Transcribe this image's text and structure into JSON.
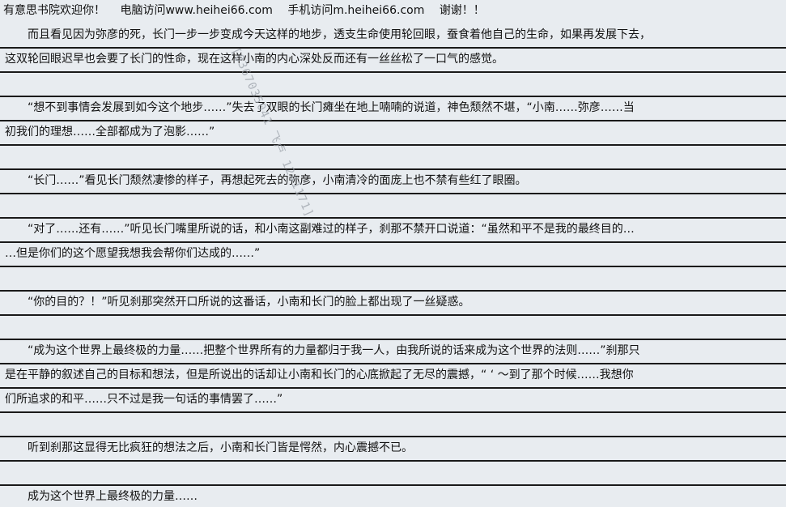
{
  "header": {
    "welcome": "有意思书院欢迎你！",
    "pc": "电脑访问www.heihei66.com",
    "mobile": "手机访问m.heihei66.com",
    "thanks": "谢谢！！"
  },
  "lines": [
    "　　而且看见因为弥彦的死，长门一步一步变成今天这样的地步，透支生命使用轮回眼，蚕食着他自己的生命，如果再发展下去，",
    "这双轮回眼迟早也会要了长门的性命，现在这样小南的内心深处反而还有一丝丝松了一口气的感觉。",
    "",
    "　　“想不到事情会发展到如今这个地步……”失去了双眼的长门瘫坐在地上喃喃的说道，神色颓然不堪，“小南……弥彦……当",
    "初我们的理想……全部都成为了泡影……”",
    "",
    "　　“长门……”看见长门颓然凄惨的样子，再想起死去的弥彦，小南清冷的面庞上也不禁有些红了眼圈。",
    "",
    "　　“对了……还有……”听见长门嘴里所说的话，和小南这副难过的样子，刹那不禁开口说道：“虽然和平不是我的最终目的…",
    "…但是你们的这个愿望我想我会帮你们达成的……”",
    "",
    "　　“你的目的？！”听见刹那突然开口所说的这番话，小南和长门的脸上都出现了一丝疑惑。",
    "",
    "　　“成为这个世界上最终极的力量……把整个世界所有的力量都归于我一人，由我所说的话来成为这个世界的法则……”刹那只",
    "是在平静的叙述自己的目标和想法，但是所说出的话却让小南和长门的心底掀起了无尽的震撼，“ ‘ ～到了那个时候……我想你",
    "们所追求的和平……只不过是我一句话的事情罢了……”",
    "",
    "　　听到刹那这显得无比疯狂的想法之后，小南和长门皆是愕然，内心震撼不已。",
    "",
    "　　成为这个世界上最终极的力量……"
  ],
  "watermark": "[0367035041 飞卢 1241171]"
}
